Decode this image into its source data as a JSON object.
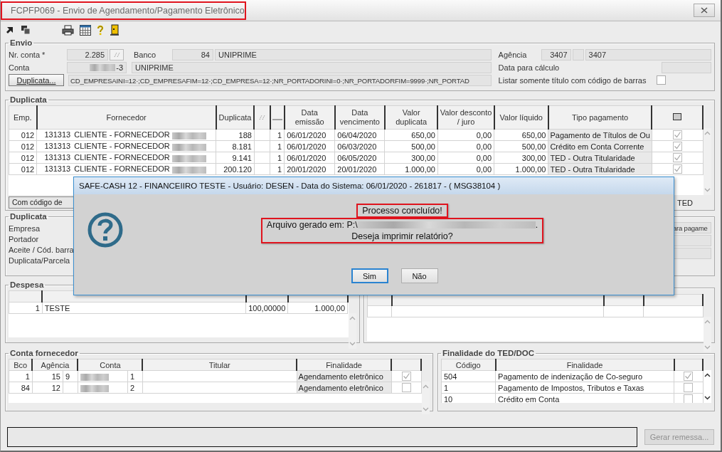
{
  "window": {
    "title": "FCPFP069 - Envio de Agendamento/Pagamento Eletrônico",
    "highlighted": true
  },
  "envio": {
    "title": "Envio",
    "nr_conta_label": "Nr. conta *",
    "nr_conta": "2.285",
    "banco_label": "Banco",
    "banco_codigo": "84",
    "banco_nome": "UNIPRIME",
    "conta_label": "Conta",
    "conta": "-3",
    "conta_redacted": true,
    "conta_nome": "UNIPRIME",
    "duplicata_button": "Duplicata...",
    "filtro": "CD_EMPRESAINI=12·;CD_EMPRESAFIM=12·;CD_EMPRESA=12·;NR_PORTADORINI=0·;NR_PORTADORFIM=9999·;NR_PORTAD",
    "agencia_label": "Agência",
    "agencia_codigo": "3407",
    "agencia_nome": "3407",
    "data_calculo_label": "Data para cálculo",
    "listar_label": "Listar somente título com código de barras",
    "listar_checked": false
  },
  "duplicatas": {
    "title": "Duplicata",
    "columns": [
      "Emp.",
      "Fornecedor",
      "Duplicata",
      "",
      "",
      "Data emissão",
      "Data vencimento",
      "Valor duplicata",
      "Valor desconto / juro",
      "Valor líquido",
      "Tipo pagamento",
      ""
    ],
    "rows": [
      {
        "emp": "012",
        "codigo": "131313",
        "fornecedor": "CLIENTE - FORNECEDOR",
        "redacted": true,
        "duplicata": "188",
        "parcela": "1",
        "emissao": "06/01/2020",
        "vencimento": "06/04/2020",
        "valor": "650,00",
        "desconto": "0,00",
        "liquido": "650,00",
        "tipo": "Pagamento de Títulos de Ou",
        "checked": true
      },
      {
        "emp": "012",
        "codigo": "131313",
        "fornecedor": "CLIENTE - FORNECEDOR",
        "redacted": true,
        "duplicata": "8.181",
        "parcela": "1",
        "emissao": "06/01/2020",
        "vencimento": "06/03/2020",
        "valor": "500,00",
        "desconto": "0,00",
        "liquido": "500,00",
        "tipo": "Crédito em Conta Corrente",
        "checked": true
      },
      {
        "emp": "012",
        "codigo": "131313",
        "fornecedor": "CLIENTE - FORNECEDOR",
        "redacted": true,
        "duplicata": "9.141",
        "parcela": "1",
        "emissao": "06/01/2020",
        "vencimento": "06/05/2020",
        "valor": "300,00",
        "desconto": "0,00",
        "liquido": "300,00",
        "tipo": "TED - Outra Titularidade",
        "checked": true
      },
      {
        "emp": "012",
        "codigo": "131313",
        "fornecedor": "CLIENTE - FORNECEDOR",
        "redacted": true,
        "duplicata": "200.120",
        "parcela": "1",
        "emissao": "20/01/2020",
        "vencimento": "20/01/2020",
        "valor": "1.000,00",
        "desconto": "0,00",
        "liquido": "1.000,00",
        "tipo": "TED - Outra Titularidade",
        "checked": true
      }
    ],
    "footer_left": "Com código de",
    "footer_right": "TED"
  },
  "duplicata_detalhe": {
    "title": "Duplicata",
    "labels": [
      "Empresa",
      "Portador",
      "Aceite / Cód. barra",
      "Duplicata/Parcela"
    ],
    "right_field": "ara pagame"
  },
  "despesa": {
    "title": "Despesa",
    "rows": [
      {
        "numero": "1",
        "despesa": "TESTE",
        "rateio": "100,00000",
        "valor": "1.000,00"
      }
    ]
  },
  "conta_fornecedor": {
    "title": "Conta fornecedor",
    "columns": [
      "Bco",
      "Agência",
      "Conta",
      "Titular",
      "Finalidade",
      ""
    ],
    "rows": [
      {
        "bco": "1",
        "agencia": "15",
        "agencia_dv": "9",
        "conta_redacted": true,
        "conta_dv": "1",
        "titular": "",
        "finalidade": "Agendamento eletrônico",
        "checked": true
      },
      {
        "bco": "84",
        "agencia": "12",
        "agencia_dv": "",
        "conta_redacted": true,
        "conta_dv": "2",
        "titular": "",
        "finalidade": "Agendamento eletrônico",
        "checked": false
      }
    ]
  },
  "finalidade_ted": {
    "title": "Finalidade do TED/DOC",
    "columns": [
      "Código",
      "Finalidade",
      ""
    ],
    "rows": [
      {
        "codigo": "504",
        "finalidade": "Pagamento de indenização de Co-seguro",
        "checked": true
      },
      {
        "codigo": "1",
        "finalidade": "Pagamento de Impostos, Tributos e Taxas",
        "checked": false
      },
      {
        "codigo": "10",
        "finalidade": "Crédito em Conta",
        "checked": false
      }
    ]
  },
  "gerar_button": {
    "label": "Gerar remessa...",
    "disabled": true
  },
  "dialog": {
    "title": "SAFE-CASH 12 - FINANCEIIRO TESTE - Usuário: DESEN - Data do Sistema: 06/01/2020 - 261817 - ( MSG38104 )",
    "blocks": [
      {
        "highlighted": true,
        "lines": [
          {
            "text": "Processo concluído!",
            "redacted": false
          }
        ]
      },
      {
        "highlighted": true,
        "lines": [
          {
            "text": "Arquivo gerado em: P:\\",
            "redacted": true,
            "after": "."
          },
          {
            "text": "Deseja imprimir relatório?",
            "redacted": false
          }
        ]
      }
    ],
    "buttons": [
      {
        "label": "Sim",
        "selected": true
      },
      {
        "label": "Não",
        "selected": false
      }
    ]
  }
}
